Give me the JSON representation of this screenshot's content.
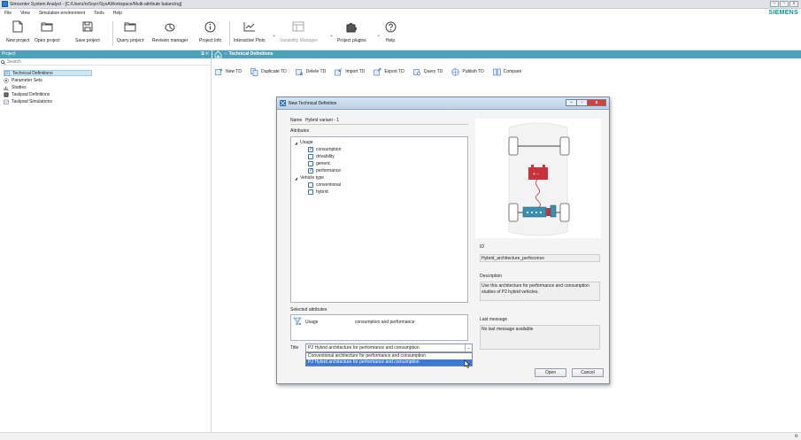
{
  "window": {
    "title": "Simcenter System Analyst - [C:/Users/ro5oyrr/SysAWorkspace/Multi-attribute balancing]"
  },
  "menu": [
    "File",
    "View",
    "Simulation environment",
    "Tools",
    "Help"
  ],
  "brand": "SIEMENS",
  "ribbon": {
    "new_project": "New project",
    "open_project": "Open project",
    "save_project": "Save project",
    "query_project": "Query project",
    "revision_manager": "Revision manager",
    "project_info": "Project Info",
    "interactive_plots": "Interactive Plots",
    "variability_manager": "Variability Manager",
    "project_plugins": "Project plugins",
    "help": "Help"
  },
  "project_panel": {
    "title": "Project",
    "search_placeholder": "Search",
    "items": [
      {
        "label": "Technical Definitions"
      },
      {
        "label": "Parameter Sets"
      },
      {
        "label": "Studies"
      },
      {
        "label": "Taskpad Definitions"
      },
      {
        "label": "Taskpad Simulations"
      }
    ]
  },
  "breadcrumb": {
    "current": "Technical Definitions"
  },
  "toolbar": {
    "new_td": "New TD",
    "duplicate_td": "Duplicate TD",
    "delete_td": "Delete TD",
    "import_td": "Import TD",
    "export_td": "Export TD",
    "query_td": "Query TD",
    "publish_td": "Publish TD",
    "compare": "Compare"
  },
  "dialog": {
    "title": "New Technical Definition",
    "name_label": "Name",
    "name_value": "Hybrid variant - 1",
    "attributes_label": "Attributes",
    "tree": {
      "usage": "Usage",
      "consumption": "consumption",
      "drivability": "drivability",
      "generic": "generic",
      "performance": "performance",
      "vehicle_type": "Vehicle type",
      "conventional": "conventional",
      "hybrid": "hybrid"
    },
    "selected_label": "Selected attributes",
    "selected_key": "Usage",
    "selected_value": "consumption and performance",
    "title_label": "Title",
    "title_value": "P2 Hybrid architecture for performance and consumption",
    "title_options": [
      "Conventional architecture for performance and consumption",
      "P2 Hybrid architecture for performance and consumption"
    ],
    "id_label": "ID",
    "id_value": "Hybrid_architecture_perfoconso",
    "description_label": "Description",
    "description_value": "Use this architecture for performance and consumption studies of P2 hybrid vehicles.",
    "last_message_label": "Last message",
    "last_message_value": "No last message available",
    "open_label": "Open",
    "cancel_label": "Cancel",
    "minimize": "–",
    "maximize": "▫",
    "close": "x"
  },
  "window_buttons": {
    "minimize": "–",
    "restore": "▫",
    "close": "x"
  },
  "colors": {
    "accent": "#4aa3b8",
    "siemens": "#0096a9",
    "battery": "#c8333a",
    "motor": "#3a8fb0"
  }
}
